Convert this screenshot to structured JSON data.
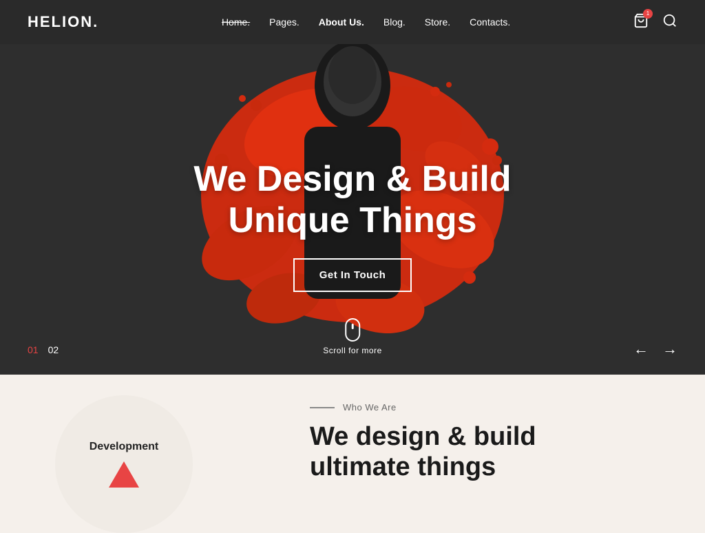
{
  "logo": {
    "text": "HELION."
  },
  "nav": {
    "items": [
      {
        "label": "Home.",
        "active": true
      },
      {
        "label": "Pages."
      },
      {
        "label": "About Us."
      },
      {
        "label": "Blog."
      },
      {
        "label": "Store."
      },
      {
        "label": "Contacts."
      }
    ]
  },
  "hero": {
    "heading_line1": "We Design & Build",
    "heading_line2": "Unique Things",
    "cta_label": "Get In Touch",
    "scroll_text": "Scroll for more",
    "slide_1": "01",
    "slide_2": "02"
  },
  "bottom": {
    "circle_title": "Development",
    "section_tag": "Who We Are",
    "section_heading_line1": "We design & build",
    "section_heading_line2": "ultimate things"
  }
}
